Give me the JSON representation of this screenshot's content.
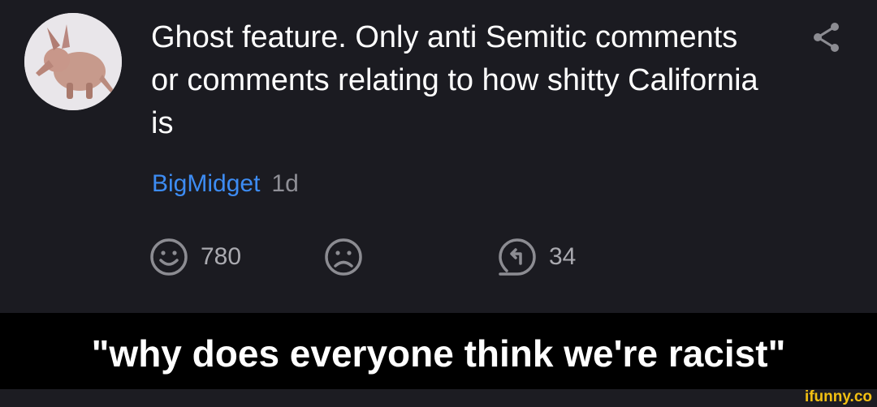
{
  "comment": {
    "text": "Ghost feature. Only anti Semitic comments or comments relating to how shitty California is",
    "author": "BigMidget",
    "age": "1d",
    "smile_count": "780",
    "reply_count": "34"
  },
  "caption": "\"why does everyone think we're racist\"",
  "watermark": "ifunny.co",
  "icons": {
    "avatar": "aardvark-avatar",
    "share": "share-icon",
    "smile": "smile-icon",
    "unsmile": "frown-icon",
    "reply": "reply-icon"
  },
  "colors": {
    "background": "#1b1b21",
    "author": "#3d8cf3",
    "meta": "#8f8f96",
    "caption_bar": "#000000",
    "watermark": "#f2c012"
  }
}
